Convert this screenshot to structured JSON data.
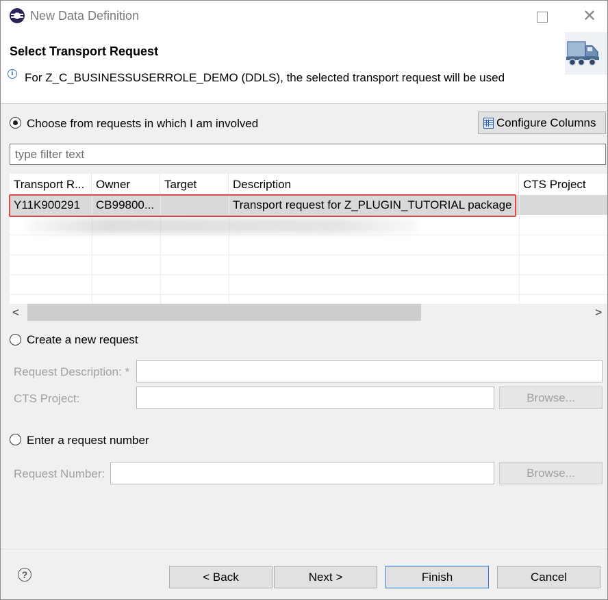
{
  "window": {
    "title": "New Data Definition",
    "maximize_icon": "maximize-icon",
    "close_icon": "close-icon"
  },
  "header": {
    "title": "Select Transport Request",
    "info": "For Z_C_BUSINESSUSERROLE_DEMO (DDLS), the selected transport request will be used",
    "info_icon": "i"
  },
  "involved": {
    "label": "Choose from requests in which I am involved",
    "selected": true,
    "configure_label": "Configure Columns",
    "filter_placeholder": "type filter text"
  },
  "table": {
    "columns": [
      "Transport R...",
      "Owner",
      "Target",
      "Description",
      "CTS Project"
    ],
    "rows": [
      {
        "transport": "Y11K900291",
        "owner": "CB99800...",
        "target": "",
        "description": "Transport request for Z_PLUGIN_TUTORIAL package",
        "cts": ""
      }
    ]
  },
  "scroll": {
    "left": "<",
    "right": ">"
  },
  "new_request": {
    "label": "Create a new request",
    "desc_label": "Request Description: *",
    "cts_label": "CTS Project:",
    "browse_label": "Browse..."
  },
  "enter_request": {
    "label": "Enter a request number",
    "number_label": "Request Number:",
    "browse_label": "Browse..."
  },
  "footer": {
    "help": "?",
    "back": "< Back",
    "next": "Next >",
    "finish": "Finish",
    "cancel": "Cancel"
  },
  "colors": {
    "highlight": "#e0484e",
    "selection": "#d9d9d9",
    "accent": "#2a78d7"
  }
}
